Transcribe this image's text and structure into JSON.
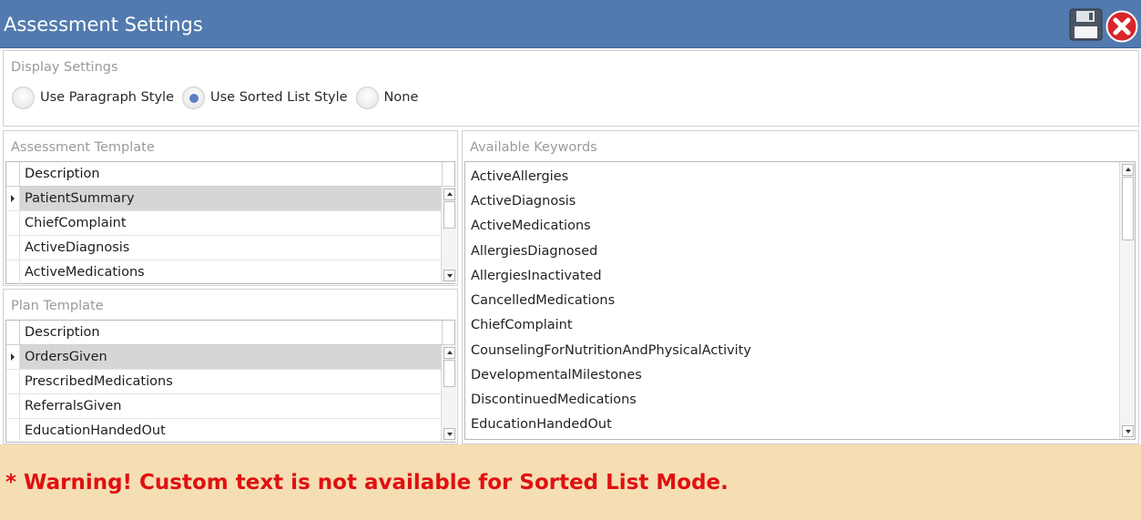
{
  "window": {
    "title": "Assessment Settings"
  },
  "display_settings": {
    "title": "Display Settings",
    "options": [
      {
        "label": "Use Paragraph Style",
        "checked": false
      },
      {
        "label": "Use Sorted List Style",
        "checked": true
      },
      {
        "label": "None",
        "checked": false
      }
    ]
  },
  "assessment_template": {
    "title": "Assessment Template",
    "column": "Description",
    "rows": [
      "PatientSummary",
      "ChiefComplaint",
      "ActiveDiagnosis",
      "ActiveMedications"
    ]
  },
  "plan_template": {
    "title": "Plan Template",
    "column": "Description",
    "rows": [
      "OrdersGiven",
      "PrescribedMedications",
      "ReferralsGiven",
      "EducationHandedOut"
    ]
  },
  "keywords": {
    "title": "Available Keywords",
    "items": [
      "ActiveAllergies",
      "ActiveDiagnosis",
      "ActiveMedications",
      "AllergiesDiagnosed",
      "AllergiesInactivated",
      "CancelledMedications",
      "ChiefComplaint",
      "CounselingForNutritionAndPhysicalActivity",
      "DevelopmentalMilestones",
      "DiscontinuedMedications",
      "EducationHandedOut"
    ]
  },
  "warning": {
    "text": "* Warning! Custom text is not available for Sorted List Mode."
  },
  "colors": {
    "titlebar": "#527aaf",
    "warning_bg": "#f5deb3",
    "warning_text": "#e01010",
    "selection": "#d6d6d6"
  },
  "icons": {
    "save": "floppy-disk-icon",
    "close": "close-x-icon"
  }
}
